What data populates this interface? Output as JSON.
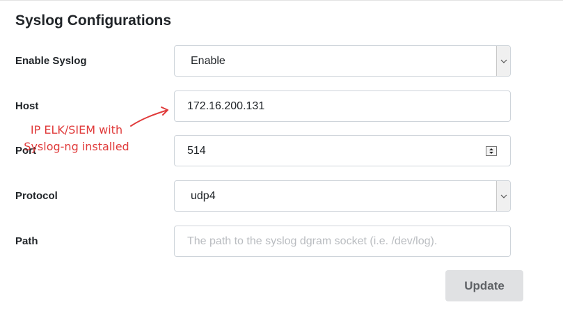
{
  "page": {
    "title": "Syslog Configurations"
  },
  "form": {
    "enable_syslog": {
      "label": "Enable Syslog",
      "value": "Enable"
    },
    "host": {
      "label": "Host",
      "value": "172.16.200.131"
    },
    "port": {
      "label": "Port",
      "value": "514"
    },
    "protocol": {
      "label": "Protocol",
      "value": "udp4"
    },
    "path": {
      "label": "Path",
      "value": "",
      "placeholder": "The path to the syslog dgram socket (i.e. /dev/log)."
    }
  },
  "actions": {
    "update_label": "Update"
  },
  "annotation": {
    "line1": "IP ELK/SIEM with",
    "line2": "Syslog-ng installed",
    "color": "#e03a3a"
  }
}
